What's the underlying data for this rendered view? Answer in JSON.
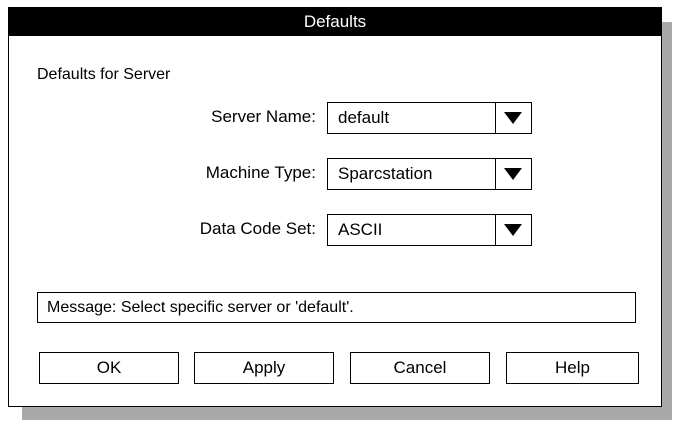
{
  "window": {
    "title": "Defaults"
  },
  "section_heading": "Defaults for Server",
  "fields": [
    {
      "label": "Server Name:",
      "value": "default"
    },
    {
      "label": "Machine Type:",
      "value": "Sparcstation"
    },
    {
      "label": "Data Code Set:",
      "value": "ASCII"
    }
  ],
  "message": "Message: Select specific server or 'default'.",
  "buttons": {
    "ok": "OK",
    "apply": "Apply",
    "cancel": "Cancel",
    "help": "Help"
  },
  "colors": {
    "titlebar_background": "#000000",
    "titlebar_text": "#ffffff",
    "shadow": "#a9a9a9"
  },
  "icons": {
    "dropdown": "triangle-down-icon"
  }
}
